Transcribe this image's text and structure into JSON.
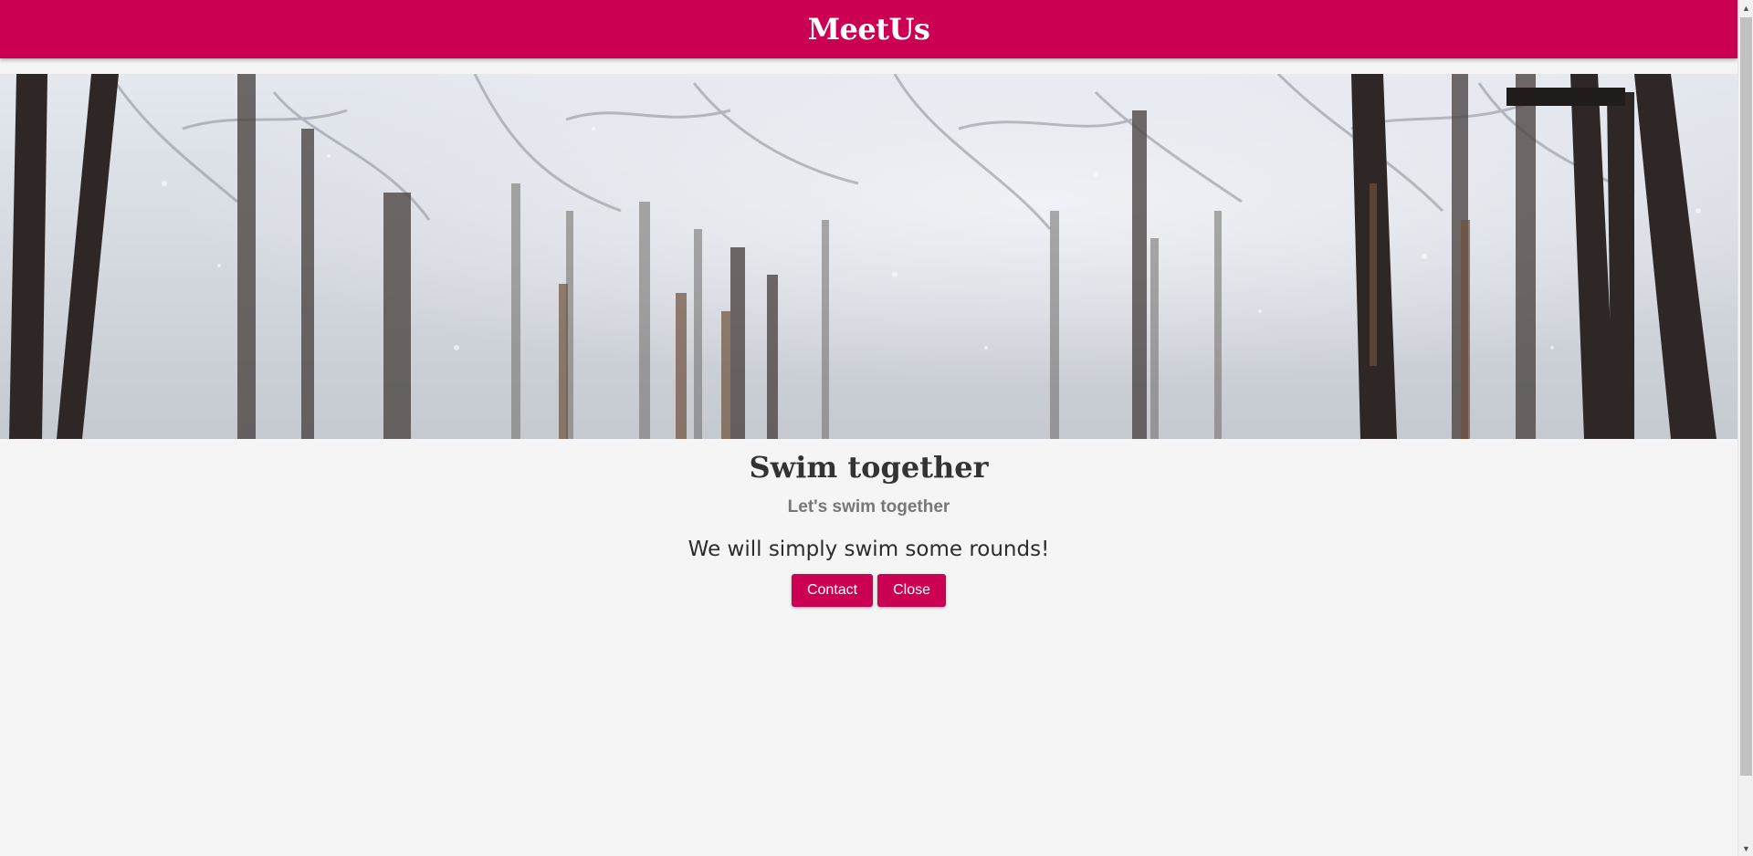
{
  "header": {
    "title": "MeetUs"
  },
  "hero": {
    "image": "snowy-forest-image"
  },
  "meetup": {
    "title": "Swim together",
    "subtitle": "Let's swim together",
    "description": "We will simply swim some rounds!"
  },
  "actions": {
    "contact_label": "Contact",
    "close_label": "Close"
  },
  "scrollbar": {
    "up_icon": "▲",
    "down_icon": "▼"
  },
  "colors": {
    "brand": "#cc0052",
    "background": "#f5f5f5",
    "title_text": "#333333",
    "subtitle_text": "#777777"
  }
}
